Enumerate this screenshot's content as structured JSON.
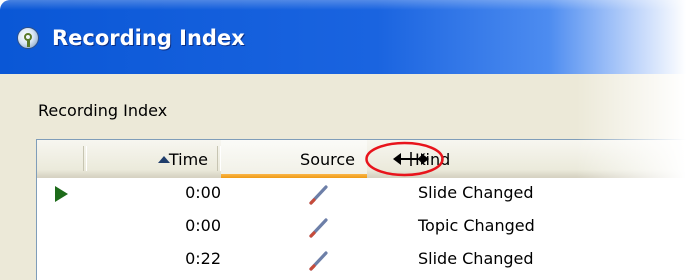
{
  "window": {
    "title": "Recording Index",
    "icon": "app-bulb-icon",
    "title_color": "#ffffff",
    "titlebar_color": "#0a57d6"
  },
  "group": {
    "label": "Recording Index"
  },
  "listview": {
    "columns": [
      {
        "key": "indicator",
        "label": ""
      },
      {
        "key": "time",
        "label": "Time",
        "sorted": "ascending"
      },
      {
        "key": "source",
        "label": "Source",
        "hot": true
      },
      {
        "key": "kind",
        "label": "Kind"
      }
    ],
    "rows": [
      {
        "playing": true,
        "time": "0:00",
        "source_icon": "pen-icon",
        "kind": "Slide Changed"
      },
      {
        "playing": false,
        "time": "0:00",
        "source_icon": "pen-icon",
        "kind": "Topic Changed"
      },
      {
        "playing": false,
        "time": "0:22",
        "source_icon": "pen-icon",
        "kind": "Slide Changed"
      }
    ]
  },
  "annotation": {
    "cursor": "column-resize-cursor",
    "highlight_color": "#e8141c"
  }
}
